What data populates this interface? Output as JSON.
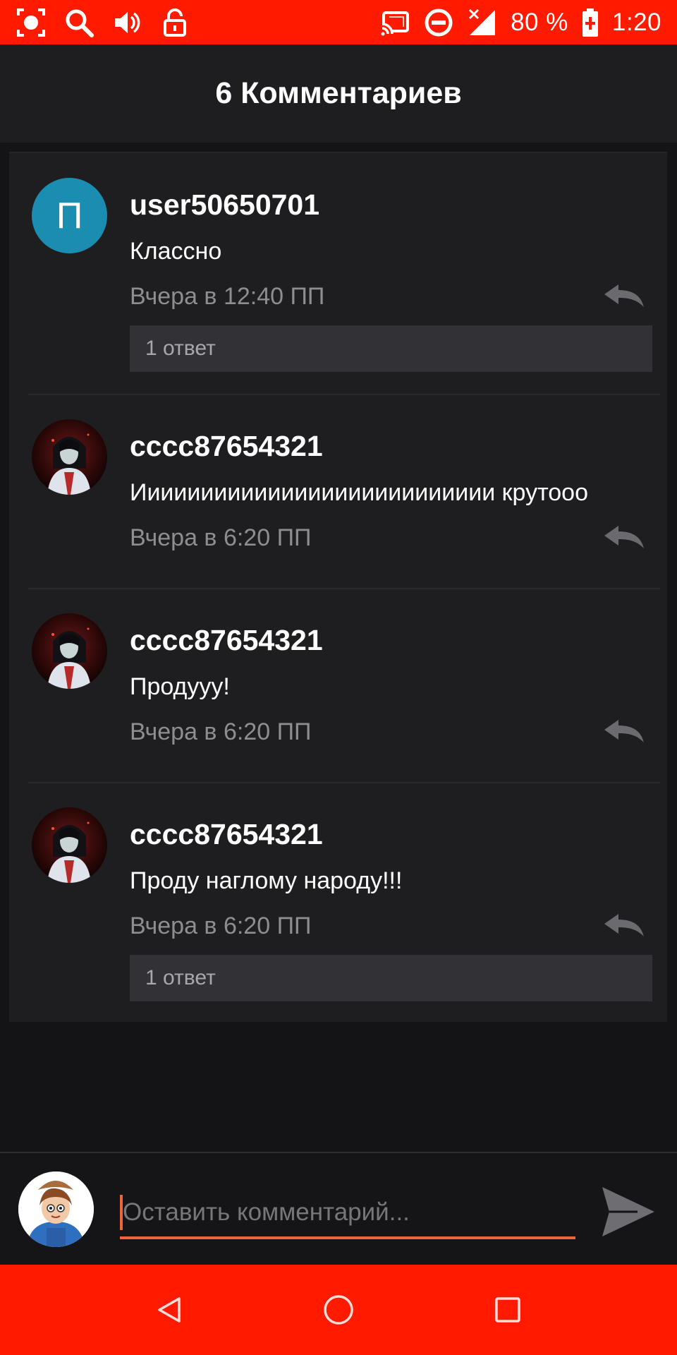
{
  "status_bar": {
    "battery": "80 %",
    "time": "1:20",
    "icons": [
      "screen-record-icon",
      "search-icon",
      "volume-icon",
      "lock-icon",
      "cast-icon",
      "do-not-disturb-icon",
      "signal-icon",
      "battery-charging-icon"
    ]
  },
  "header": {
    "title": "6 Комментариев"
  },
  "comments": [
    {
      "username": "user50650701",
      "avatar_letter": "П",
      "text": "Классно",
      "time": "Вчера в 12:40 ПП",
      "replies": "1 ответ"
    },
    {
      "username": "cccc87654321",
      "text": "Иииииииииииииииииииииииииии крутооо",
      "time": "Вчера в 6:20 ПП"
    },
    {
      "username": "cccc87654321",
      "text": "Продууу!",
      "time": "Вчера в 6:20 ПП"
    },
    {
      "username": "cccc87654321",
      "text": "Проду наглому народу!!!",
      "time": "Вчера в 6:20 ПП",
      "replies": "1 ответ"
    }
  ],
  "input": {
    "placeholder": "Оставить комментарий..."
  },
  "colors": {
    "accent": "#ff1a00",
    "input_underline": "#f0643c",
    "avatar_bg": "#1b8db0"
  }
}
